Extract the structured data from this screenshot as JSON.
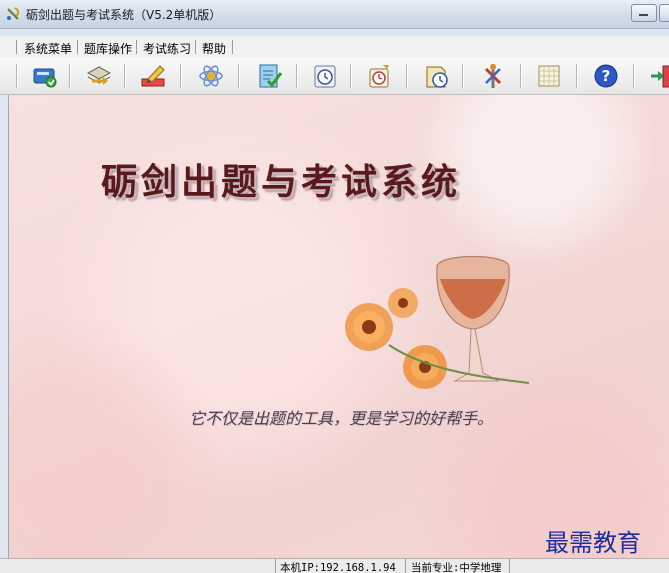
{
  "window": {
    "title": "砺剑出题与考试系统（V5.2单机版）"
  },
  "menu": {
    "items": [
      {
        "label": "系统菜单"
      },
      {
        "label": "题库操作"
      },
      {
        "label": "考试练习"
      },
      {
        "label": "帮助"
      }
    ]
  },
  "toolbar": {
    "icons": [
      "card-icon",
      "stack-transfer-icon",
      "edit-pencil-icon",
      "atom-icon",
      "checklist-icon",
      "clock-page-icon",
      "alarm-clock-icon",
      "history-clock-icon",
      "tools-icon",
      "grid-sheet-icon",
      "help-icon",
      "exit-door-icon"
    ]
  },
  "main": {
    "banner_title": "砺剑出题与考试系统",
    "slogan": "它不仅是出题的工具，更是学习的好帮手。"
  },
  "status": {
    "ip": "本机IP:192.168.1.94",
    "major": "当前专业:中学地理"
  },
  "watermark": {
    "text": "最需教育"
  },
  "colors": {
    "titlebar": "#d3dcea",
    "background_pink": "#f3dad8",
    "banner_text": "#5a1a1a",
    "watermark": "#1d2f9c"
  }
}
